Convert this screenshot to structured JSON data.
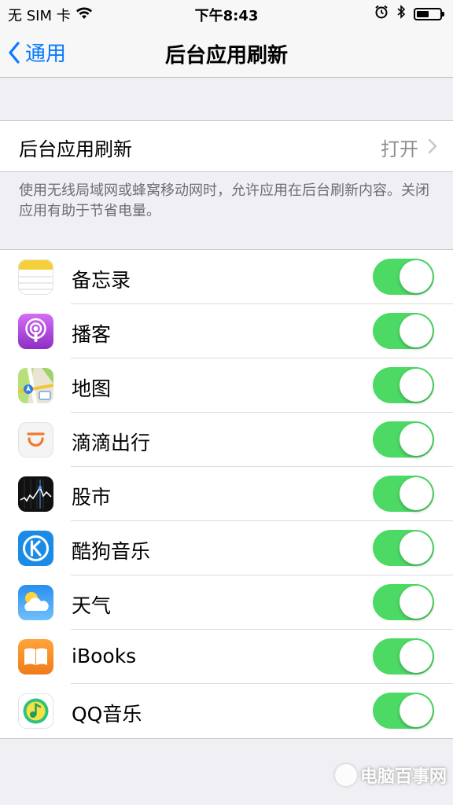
{
  "status_bar": {
    "carrier": "无 SIM 卡",
    "time": "下午8:43",
    "battery_level": 0.55
  },
  "nav": {
    "back_label": "通用",
    "title": "后台应用刷新"
  },
  "main_setting": {
    "label": "后台应用刷新",
    "value": "打开"
  },
  "footer_note": "使用无线局域网或蜂窝移动网时，允许应用在后台刷新内容。关闭应用有助于节省电量。",
  "apps": [
    {
      "name": "备忘录",
      "icon": "notes-icon",
      "enabled": true
    },
    {
      "name": "播客",
      "icon": "podcasts-icon",
      "enabled": true
    },
    {
      "name": "地图",
      "icon": "maps-icon",
      "enabled": true
    },
    {
      "name": "滴滴出行",
      "icon": "didi-icon",
      "enabled": true
    },
    {
      "name": "股市",
      "icon": "stocks-icon",
      "enabled": true
    },
    {
      "name": "酷狗音乐",
      "icon": "kugou-icon",
      "enabled": true
    },
    {
      "name": "天气",
      "icon": "weather-icon",
      "enabled": true
    },
    {
      "name": "iBooks",
      "icon": "ibooks-icon",
      "enabled": true
    },
    {
      "name": "QQ音乐",
      "icon": "qqmusic-icon",
      "enabled": true
    }
  ],
  "watermark": {
    "text": "电脑百事网"
  },
  "colors": {
    "accent": "#0a7aff",
    "toggle_on": "#4cd964",
    "background": "#efeff4"
  }
}
